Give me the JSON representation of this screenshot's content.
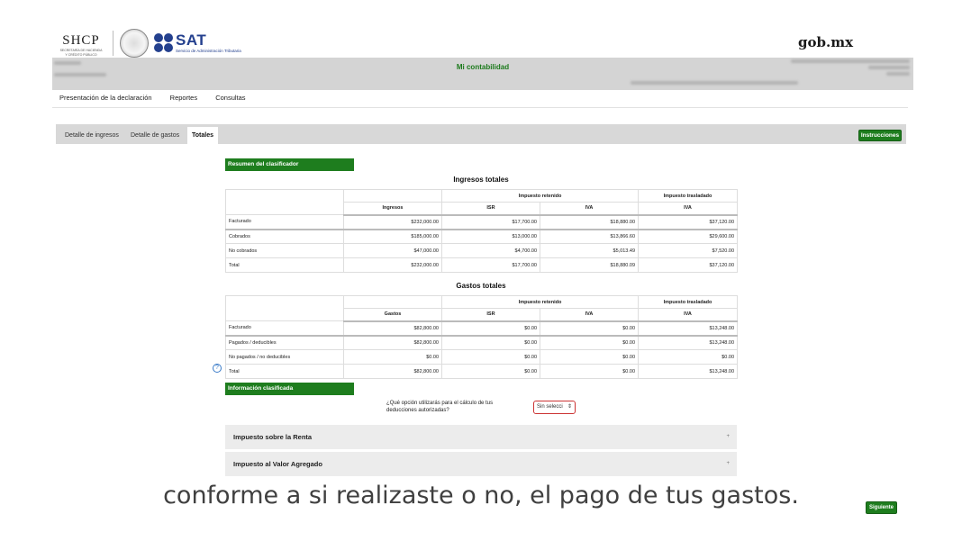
{
  "header": {
    "shcp_text": "SHCP",
    "shcp_sub_lines": [
      "SECRETARÍA DE HACIENDA",
      "Y CRÉDITO PÚBLICO"
    ],
    "sat_text": "SAT",
    "sat_sub": "Servicio de Administración Tributaria",
    "gob_text": "gob.mx",
    "brand_blue": "#24408e"
  },
  "banner": {
    "title": "Mi contabilidad"
  },
  "top_nav": [
    "Presentación de la declaración",
    "Reportes",
    "Consultas"
  ],
  "tabs": [
    "Detalle de ingresos",
    "Detalle de gastos",
    "Totales"
  ],
  "active_tab": "Totales",
  "instrucciones_label": "Instrucciones",
  "accent_green": "#1e7d1e",
  "resumen": {
    "section_label": "Resumen del clasificador",
    "ingresos": {
      "title": "Ingresos totales",
      "group_retenido": "Impuesto retenido",
      "group_trasladado": "Impuesto trasladado",
      "col_main": "Ingresos",
      "col_isr": "ISR",
      "col_iva": "IVA",
      "col_iva2": "IVA",
      "rows": [
        [
          "Facturado",
          "$232,000.00",
          "$17,700.00",
          "$18,880.00",
          "$37,120.00"
        ],
        [
          "Cobrados",
          "$185,000.00",
          "$13,000.00",
          "$13,866.60",
          "$29,600.00"
        ],
        [
          "No cobrados",
          "$47,000.00",
          "$4,700.00",
          "$5,013.49",
          "$7,520.00"
        ],
        [
          "Total",
          "$232,000.00",
          "$17,700.00",
          "$18,880.09",
          "$37,120.00"
        ]
      ]
    },
    "gastos": {
      "title": "Gastos totales",
      "group_retenido": "Impuesto retenido",
      "group_trasladado": "Impuesto trasladado",
      "col_main": "Gastos",
      "col_isr": "ISR",
      "col_iva": "IVA",
      "col_iva2": "IVA",
      "rows": [
        [
          "Facturado",
          "$82,800.00",
          "$0.00",
          "$0.00",
          "$13,248.00"
        ],
        [
          "Pagados / deducibles",
          "$82,800.00",
          "$0.00",
          "$0.00",
          "$13,248.00"
        ],
        [
          "No pagados / no deducibles",
          "$0.00",
          "$0.00",
          "$0.00",
          "$0.00"
        ],
        [
          "Total",
          "$82,800.00",
          "$0.00",
          "$0.00",
          "$13,248.00"
        ]
      ]
    }
  },
  "help_icon": "?",
  "info": {
    "section_label": "Información clasificada",
    "question": "¿Qué opción utilizarás para el cálculo de tus deducciones autorizadas?",
    "select_value": "Sin selecci",
    "select_arrow": "⇕"
  },
  "accordions": [
    {
      "label": "Impuesto sobre la Renta",
      "icon": "+"
    },
    {
      "label": "Impuesto al Valor Agregado",
      "icon": "+"
    }
  ],
  "siguiente_label": "Siguiente",
  "subtitle": "conforme a si realizaste o no, el pago de tus gastos."
}
